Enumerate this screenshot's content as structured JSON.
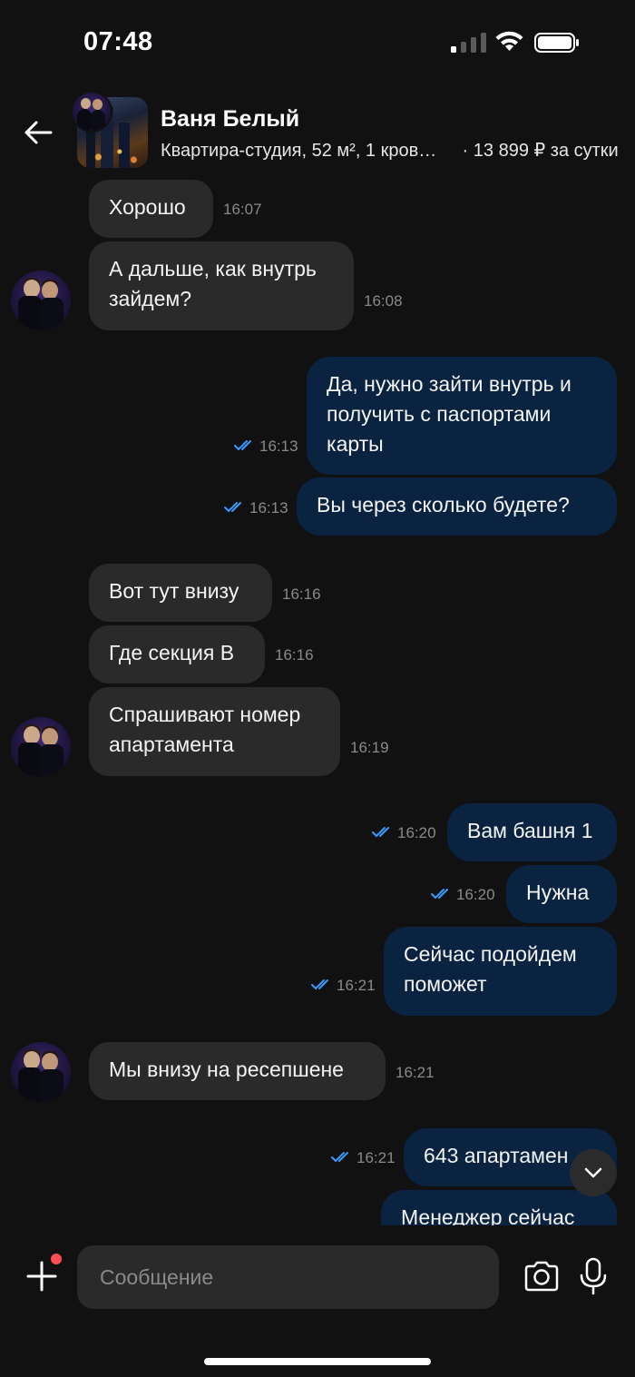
{
  "status_bar": {
    "time": "07:48"
  },
  "header": {
    "name": "Ваня Белый",
    "listing_title": "Квартира-студия, 52 м², 1 кров…",
    "listing_price": " · 13 899 ₽ за сутки"
  },
  "messages": [
    {
      "dir": "in",
      "text": "Хорошо",
      "time": "16:07"
    },
    {
      "dir": "in",
      "text": "А дальше, как внутрь зайдем?",
      "time": "16:08"
    },
    {
      "dir": "out",
      "text": "Да, нужно зайти внутрь и получить с паспортами карты",
      "time": "16:13",
      "read": true
    },
    {
      "dir": "out",
      "text": "Вы через сколько будете?",
      "time": "16:13",
      "read": true
    },
    {
      "dir": "in",
      "text": "Вот тут внизу",
      "time": "16:16"
    },
    {
      "dir": "in",
      "text": "Где секция В",
      "time": "16:16"
    },
    {
      "dir": "in",
      "text": "Спрашивают номер апартамента",
      "time": "16:19"
    },
    {
      "dir": "out",
      "text": "Вам башня 1",
      "time": "16:20",
      "read": true
    },
    {
      "dir": "out",
      "text": "Нужна",
      "time": "16:20",
      "read": true
    },
    {
      "dir": "out",
      "text": "Сейчас подойдем поможет",
      "time": "16:21",
      "read": true
    },
    {
      "dir": "in",
      "text": "Мы внизу на ресепшене",
      "time": "16:21"
    },
    {
      "dir": "out",
      "text": "643 апартамен",
      "time": "16:21",
      "read": true
    },
    {
      "dir": "out",
      "text": "Менеджер сейчас",
      "time": ""
    }
  ],
  "composer": {
    "placeholder": "Сообщение"
  },
  "colors": {
    "incoming": "#2a2a2a",
    "outgoing": "#0a2340",
    "read_ticks": "#3b9bff",
    "badge": "#ff4d55"
  }
}
